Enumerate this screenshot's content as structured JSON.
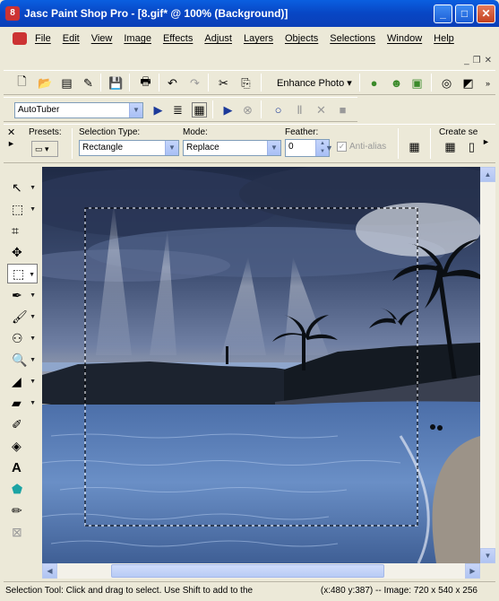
{
  "window": {
    "title": "Jasc Paint Shop Pro - [8.gif* @ 100% (Background)]",
    "app_icon_text": "8",
    "minimize": "_",
    "maximize": "□",
    "close": "✕"
  },
  "menu": {
    "items": [
      "File",
      "Edit",
      "View",
      "Image",
      "Effects",
      "Adjust",
      "Layers",
      "Objects",
      "Selections",
      "Window",
      "Help"
    ],
    "mdi_controls": [
      "_",
      "❐",
      "✕"
    ]
  },
  "toolbar": {
    "enhance_label": "Enhance Photo ▾"
  },
  "script_toolbar": {
    "script_value": "AutoTuber"
  },
  "tool_options": {
    "presets_label": "Presets:",
    "selection_type_label": "Selection Type:",
    "selection_type_value": "Rectangle",
    "mode_label": "Mode:",
    "mode_value": "Replace",
    "feather_label": "Feather:",
    "feather_value": "0",
    "antialias_label": "Anti-alias",
    "create_label": "Create se"
  },
  "status": {
    "left": "Selection Tool: Click and drag to select. Use Shift to add to the",
    "right": "(x:480 y:387) -- Image:  720 x 540 x 256"
  },
  "colors": {
    "title_blue": "#0846c4",
    "sky_dark": "#27324e",
    "water": "#5a7fb5"
  }
}
